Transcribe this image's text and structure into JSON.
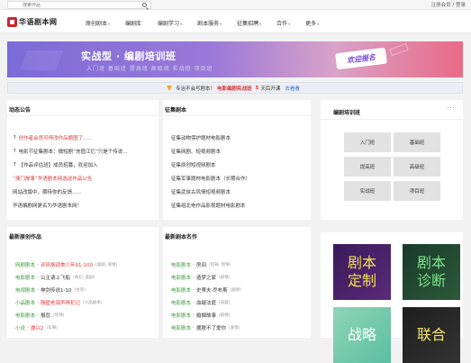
{
  "topbar": {
    "search_placeholder": "搜索作品",
    "login": "注册会员 / 登录"
  },
  "logo": {
    "text": "华语剧本网"
  },
  "nav": [
    {
      "label": "原创剧本",
      "caret": "▾"
    },
    {
      "label": "编剧库",
      "caret": ""
    },
    {
      "label": "编剧学习",
      "caret": "▾"
    },
    {
      "label": "剧本服务",
      "caret": "▾"
    },
    {
      "label": "征集招聘",
      "caret": "▾"
    },
    {
      "label": "合作",
      "caret": "▾"
    },
    {
      "label": "更多",
      "caret": "▾"
    }
  ],
  "banner": {
    "title": "实战型 · 编剧培训班",
    "subtitle": "入门班  基础班  提高班  高级班  实战班  项目班",
    "cta": "欢迎报名"
  },
  "notice": {
    "prefix": "专治不会写剧本！",
    "course": "电影编剧实战班",
    "count": "5",
    "suffix": "天后开课",
    "link": "去看看"
  },
  "announcements": {
    "title": "动态公告",
    "items": [
      {
        "pre": "↑",
        "text": "创作者会员可停改作品题图了......",
        "red": true
      },
      {
        "pre": "↑",
        "text": "电影节征集剧本：微短剧“充值江忆”只是个传说...",
        "red": false
      },
      {
        "pre": "↑",
        "text": "【作品评估班】成员招募，欢迎加入",
        "red": false
      },
      {
        "pre": "",
        "text": "“澳门故事”华语剧本网选送作品公告",
        "red": true
      },
      {
        "pre": "",
        "text": "网站改版中，期待你的反馈......",
        "red": false
      },
      {
        "pre": "",
        "text": "华语编剧网更名为华语剧本网！",
        "red": false
      }
    ]
  },
  "collection": {
    "title": "征集剧本",
    "items": [
      "征集动物保护题材电影剧本",
      "征集网剧、短视频剧本",
      "征集原创短视频剧本",
      "征集军事题材电影剧本（长期合作）",
      "征集武侠古风情短视频剧本",
      "征集组北电作品影视题材电影剧本"
    ]
  },
  "training": {
    "title": "编剧培训班",
    "dots": "···",
    "classes": [
      "入门班",
      "基础班",
      "提高班",
      "高级班",
      "实战班",
      "项目班"
    ]
  },
  "works": {
    "title": "最新原创作品",
    "items": [
      {
        "cat": "网剧剧本",
        "title": "评风格调美少年91-100",
        "red": true,
        "tag": "(喜剧, 爱情)"
      },
      {
        "cat": "电影剧本",
        "title": "公主请上飞船",
        "red": false,
        "tag": "(奇幻, 喜剧)"
      },
      {
        "cat": "电视剧本",
        "title": "神剑传说1-10",
        "red": false,
        "tag": "(古装)"
      },
      {
        "cat": "小品剧本",
        "title": "隔壁老海声再犯记",
        "red": true,
        "tag": "(小品剧本)"
      },
      {
        "cat": "电影剧本",
        "title": "报怨",
        "red": false,
        "tag": "(惊悚)"
      },
      {
        "cat": "小说",
        "title": "虞兴2",
        "red": true,
        "tag": "(军事)"
      }
    ]
  },
  "masterpieces": {
    "title": "最新剧本名作",
    "items": [
      {
        "cat": "电影剧本",
        "title": "房间",
        "tag": "(犯罪, 惊悚)"
      },
      {
        "cat": "电影剧本",
        "title": "造梦之家",
        "tag": "(剧情)"
      },
      {
        "cat": "电影剧本",
        "title": "史蒂夫·乔布斯",
        "tag": "(剧情)"
      },
      {
        "cat": "电影剧本",
        "title": "血疑法庭",
        "tag": "(悬疑)"
      },
      {
        "cat": "电影剧本",
        "title": "婚姻故事",
        "tag": "(剧情)"
      },
      {
        "cat": "电影剧本",
        "title": "摆脱不了爱你",
        "tag": "(爱情)"
      }
    ]
  },
  "services": {
    "tiles": [
      "剧本\n定制",
      "剧本\n诊断",
      "战略",
      "联合"
    ]
  }
}
